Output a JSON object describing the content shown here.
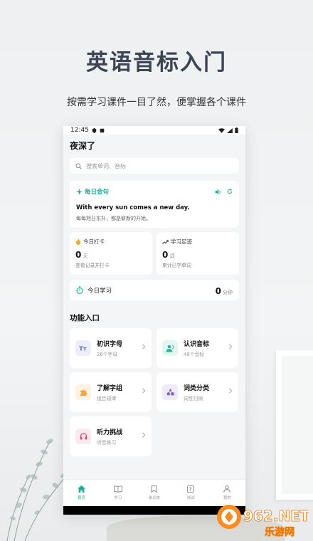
{
  "promo": {
    "title": "英语音标入门",
    "subtitle": "按需学习课件一目了然，便掌握各个课件"
  },
  "status_bar": {
    "time": "12:45"
  },
  "header": {
    "title": "夜深了"
  },
  "search": {
    "placeholder": "搜索单词、音标"
  },
  "daily_sentence": {
    "title": "每日金句",
    "english": "With every sun comes a new day.",
    "chinese": "每每旭日东升，都是崭新的开始。"
  },
  "stats": [
    {
      "title": "今日打卡",
      "value": "0",
      "unit": "天",
      "desc": "查看记录并打卡"
    },
    {
      "title": "学习足迹",
      "value": "0",
      "unit": "词",
      "desc": "累计已学单词"
    }
  ],
  "today_study": {
    "label": "今日学习",
    "value": "0",
    "unit": "分钟"
  },
  "section": {
    "title": "功能入口"
  },
  "features": [
    {
      "title": "初识字母",
      "desc": "26个字母",
      "icon": "letters-icon",
      "color": "#5b6bc0",
      "bg": "#eceef8"
    },
    {
      "title": "认识音标",
      "desc": "48个音标",
      "icon": "phonetics-icon",
      "color": "#2fb59a",
      "bg": "#e3f6f1"
    },
    {
      "title": "了解字组",
      "desc": "组合规律",
      "icon": "puzzle-icon",
      "color": "#f0a93a",
      "bg": "#fdf2e1"
    },
    {
      "title": "词类分类",
      "desc": "词性归纳",
      "icon": "shapes-icon",
      "color": "#7b5cc4",
      "bg": "#efe9f8"
    },
    {
      "title": "听力挑战",
      "desc": "听音练习",
      "icon": "headphones-icon",
      "color": "#e0456a",
      "bg": "#fce8ee"
    }
  ],
  "tabs": [
    {
      "label": "首页",
      "icon": "home-icon",
      "active": true
    },
    {
      "label": "学习",
      "icon": "book-icon",
      "active": false
    },
    {
      "label": "单词本",
      "icon": "bookmark-icon",
      "active": false
    },
    {
      "label": "测试",
      "icon": "quiz-icon",
      "active": false
    },
    {
      "label": "我的",
      "icon": "profile-icon",
      "active": false
    }
  ],
  "watermark": {
    "brand": "962.NET",
    "site": "乐游网"
  },
  "colors": {
    "accent": "#18b39a",
    "promo_title": "#3b4556"
  }
}
